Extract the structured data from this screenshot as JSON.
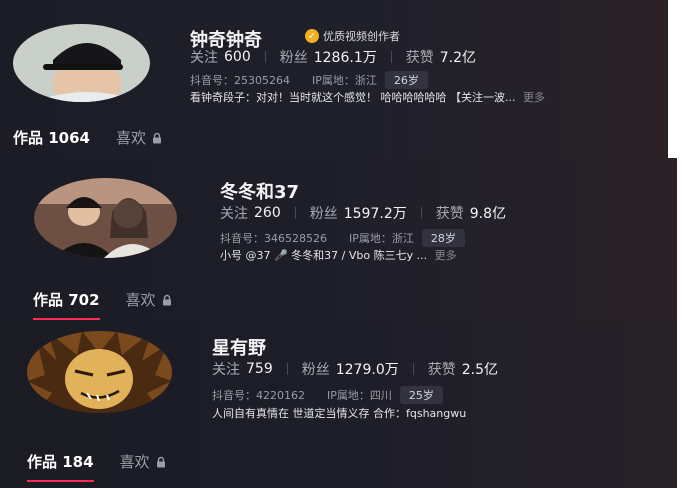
{
  "profiles": [
    {
      "name": "钟奇钟奇",
      "badge": "优质视频创作者",
      "stats": [
        {
          "k": "关注",
          "v": "600"
        },
        {
          "k": "粉丝",
          "v": "1286.1万"
        },
        {
          "k": "获赞",
          "v": "7.2亿"
        }
      ],
      "id_label": "抖音号：",
      "id": "25305264",
      "ip": "IP属地：浙江",
      "age": "26岁",
      "bio": "看钟奇段子：对对！当时就这个感觉！ 哈哈哈哈哈哈 【关注一波...",
      "more": "更多",
      "works": "作品 1064",
      "likes": "喜欢"
    },
    {
      "name": "冬冬和37",
      "stats": [
        {
          "k": "关注",
          "v": "260"
        },
        {
          "k": "粉丝",
          "v": "1597.2万"
        },
        {
          "k": "获赞",
          "v": "9.8亿"
        }
      ],
      "id_label": "抖音号：",
      "id": "346528526",
      "ip": "IP属地：浙江",
      "age": "28岁",
      "bio": "小号 @37 🎤 冬冬和37 / Vbo 陈三七y ...",
      "more": "更多",
      "works": "作品 702",
      "likes": "喜欢"
    },
    {
      "name": "星有野",
      "stats": [
        {
          "k": "关注",
          "v": "759"
        },
        {
          "k": "粉丝",
          "v": "1279.0万"
        },
        {
          "k": "获赞",
          "v": "2.5亿"
        }
      ],
      "id_label": "抖音号：",
      "id": "4220162",
      "ip": "IP属地：四川",
      "age": "25岁",
      "bio": "人间自有真情在 世道定当情义存 合作：fqshangwu",
      "works": "作品 184",
      "likes": "喜欢"
    }
  ],
  "colors": {
    "accent": "#fe2c55",
    "badge": "#f0b020",
    "bg": "#1e1e29"
  }
}
